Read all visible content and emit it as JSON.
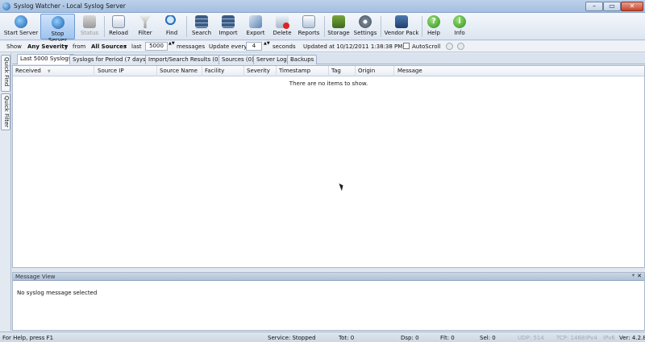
{
  "window": {
    "title": "Syslog Watcher - Local Syslog Server",
    "min": "–",
    "max": "▭",
    "close": "✕"
  },
  "toolbar": {
    "start_server": "Start Server",
    "stop_server": "Stop Server",
    "status": "Status",
    "reload": "Reload",
    "filter": "Filter",
    "find": "Find",
    "search": "Search",
    "import": "Import",
    "export": "Export",
    "delete": "Delete",
    "reports": "Reports",
    "storage": "Storage",
    "settings": "Settings",
    "vendor_pack": "Vendor Pack",
    "help": "Help",
    "info": "Info",
    "help_glyph": "?",
    "info_glyph": "i"
  },
  "filterbar": {
    "show": "Show",
    "severity": "Any Severity",
    "from": "from",
    "sources": "All Sources",
    "last": "last",
    "count": "5000",
    "messages": "messages",
    "update_every": "Update every",
    "interval": "4",
    "seconds": "seconds",
    "updated_at": "Updated at  10/12/2011 1:38:38 PM",
    "autoscroll": "AutoScroll",
    "dropdown_glyph": "▾",
    "spin_glyph": "▲▼"
  },
  "sidebar": {
    "quick_find": "Quick Find",
    "quick_filter": "Quick Filter"
  },
  "tabs": [
    {
      "label": "Last 5000 Syslogs"
    },
    {
      "label": "Syslogs for Period (7 days)"
    },
    {
      "label": "Import/Search Results (0)"
    },
    {
      "label": "Sources (0)"
    },
    {
      "label": "Server Log"
    },
    {
      "label": "Backups"
    }
  ],
  "grid": {
    "columns": [
      "Received",
      "Source IP",
      "Source Name",
      "Facility",
      "Severity",
      "Timestamp",
      "Tag",
      "Origin",
      "Message"
    ],
    "sort_glyph": "▼",
    "empty_text": "There are no items to show."
  },
  "message_view": {
    "title": "Message View",
    "pin": "ᵠ",
    "close": "✕",
    "text": "No syslog message selected"
  },
  "statusbar": {
    "help": "For Help, press F1",
    "service": "Service: Stopped",
    "tot": "Tot: 0",
    "dsp": "Dsp: 0",
    "flt": "Flt: 0",
    "sel": "Sel: 0",
    "udp": "UDP: 514",
    "tcp": "TCP: 1468",
    "ipv4": "IPv4",
    "ipv6": "IPv6",
    "ver": "Ver: 4.2.8"
  },
  "colors": {
    "accent": "#6f9bd2",
    "toolbar_bg": "#dce5f0",
    "status_stopped": "#111111"
  }
}
